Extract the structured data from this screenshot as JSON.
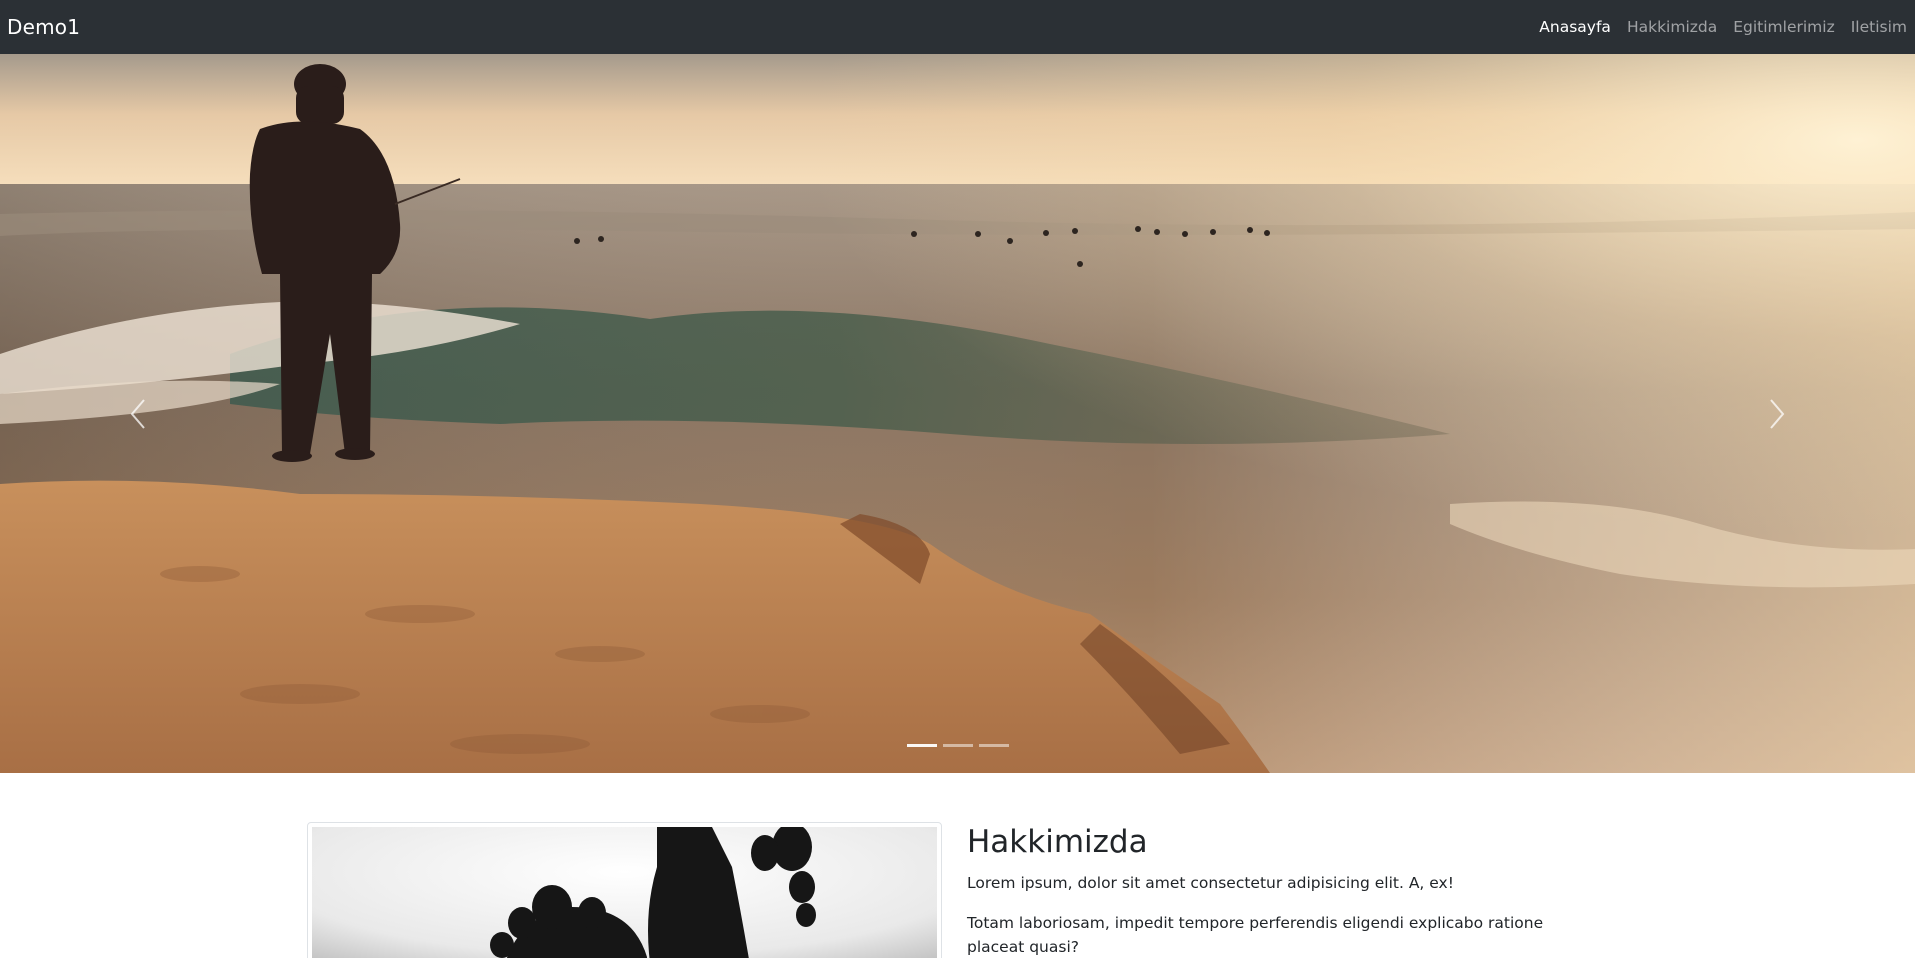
{
  "navbar": {
    "brand": "Demo1",
    "links": [
      {
        "label": "Anasayfa",
        "active": true
      },
      {
        "label": "Hakkimizda",
        "active": false
      },
      {
        "label": "Egitimlerimiz",
        "active": false
      },
      {
        "label": "Iletisim",
        "active": false
      }
    ]
  },
  "carousel": {
    "slide_count": 3,
    "active_slide": 1,
    "image_subject": "fisherman standing on a sandy cliff above ocean waves at sunset"
  },
  "about": {
    "title": "Hakkimizda",
    "paragraphs": [
      "Lorem ipsum, dolor sit amet consectetur adipisicing elit. A, ex!",
      "Totam laboriosam, impedit tempore perferendis eligendi explicabo ratione placeat quasi?"
    ],
    "image_subject": "black and white photo of feet"
  },
  "colors": {
    "navbar_bg": "#2b3035",
    "nav_active": "#ffffff",
    "nav_inactive": "rgba(255,255,255,0.55)"
  },
  "icons": [
    "chevron-left-icon",
    "chevron-right-icon"
  ]
}
